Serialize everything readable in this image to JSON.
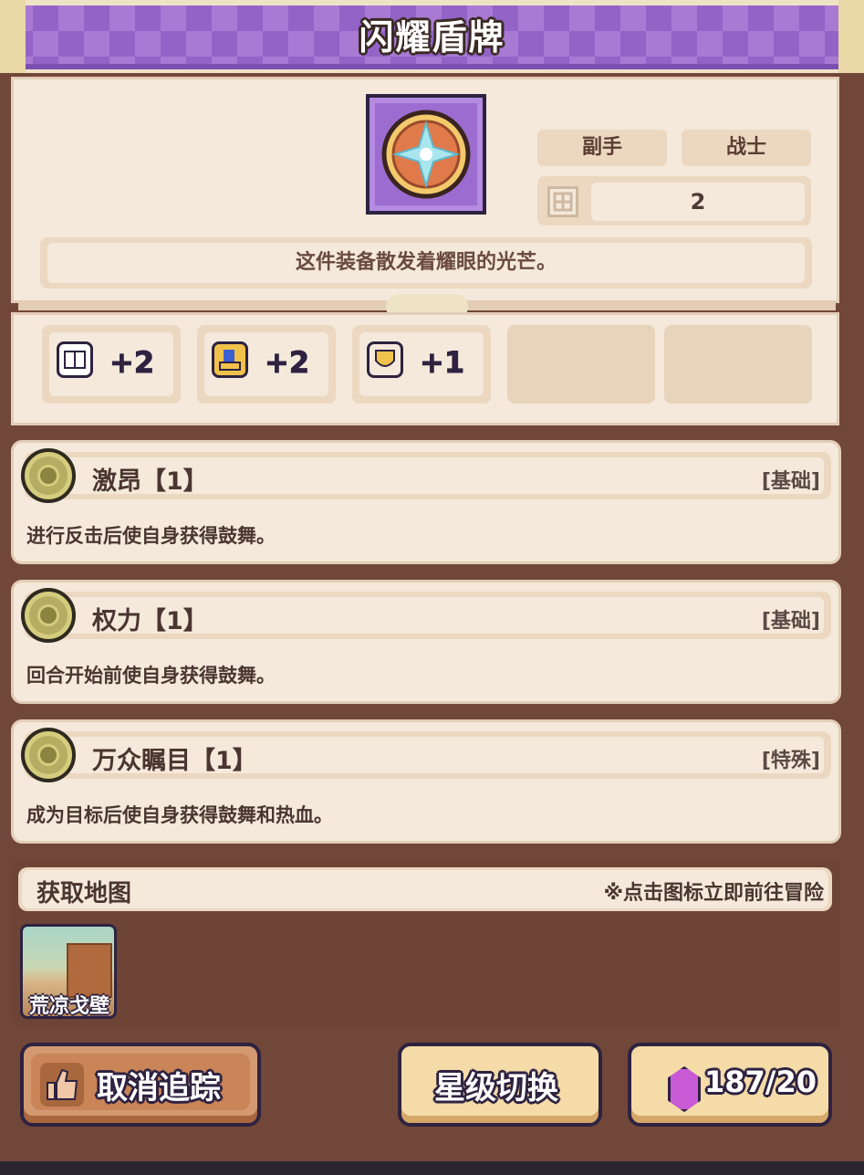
{
  "header": {
    "title": "闪耀盾牌"
  },
  "item": {
    "icon": "shield-emblem-icon",
    "slot": "副手",
    "class": "战士",
    "slot_icon": "slot-grid-icon",
    "slot_count": "2",
    "description": "这件装备散发着耀眼的光芒。"
  },
  "stats": [
    {
      "icon": "book-icon",
      "value": "+2"
    },
    {
      "icon": "boot-icon",
      "value": "+2"
    },
    {
      "icon": "shield-icon",
      "value": "+1"
    }
  ],
  "traits": [
    {
      "name": "激昂【1】",
      "tag": "[基础]",
      "description": "进行反击后使自身获得鼓舞。"
    },
    {
      "name": "权力【1】",
      "tag": "[基础]",
      "description": "回合开始前使自身获得鼓舞。"
    },
    {
      "name": "万众瞩目【1】",
      "tag": "[特殊]",
      "description": "成为目标后使自身获得鼓舞和热血。"
    }
  ],
  "map": {
    "title": "获取地图",
    "hint": "※点击图标立即前往冒险",
    "locations": [
      {
        "label": "荒凉戈壁"
      }
    ]
  },
  "buttons": {
    "untrack": "取消追踪",
    "star_switch": "星级切换",
    "gem_cost": "187/20"
  },
  "colors": {
    "title_purple": "#a97ad4",
    "panel_bg": "#f4e9db",
    "frame_brown": "#71473a",
    "gem_pink": "#c85ad6"
  }
}
